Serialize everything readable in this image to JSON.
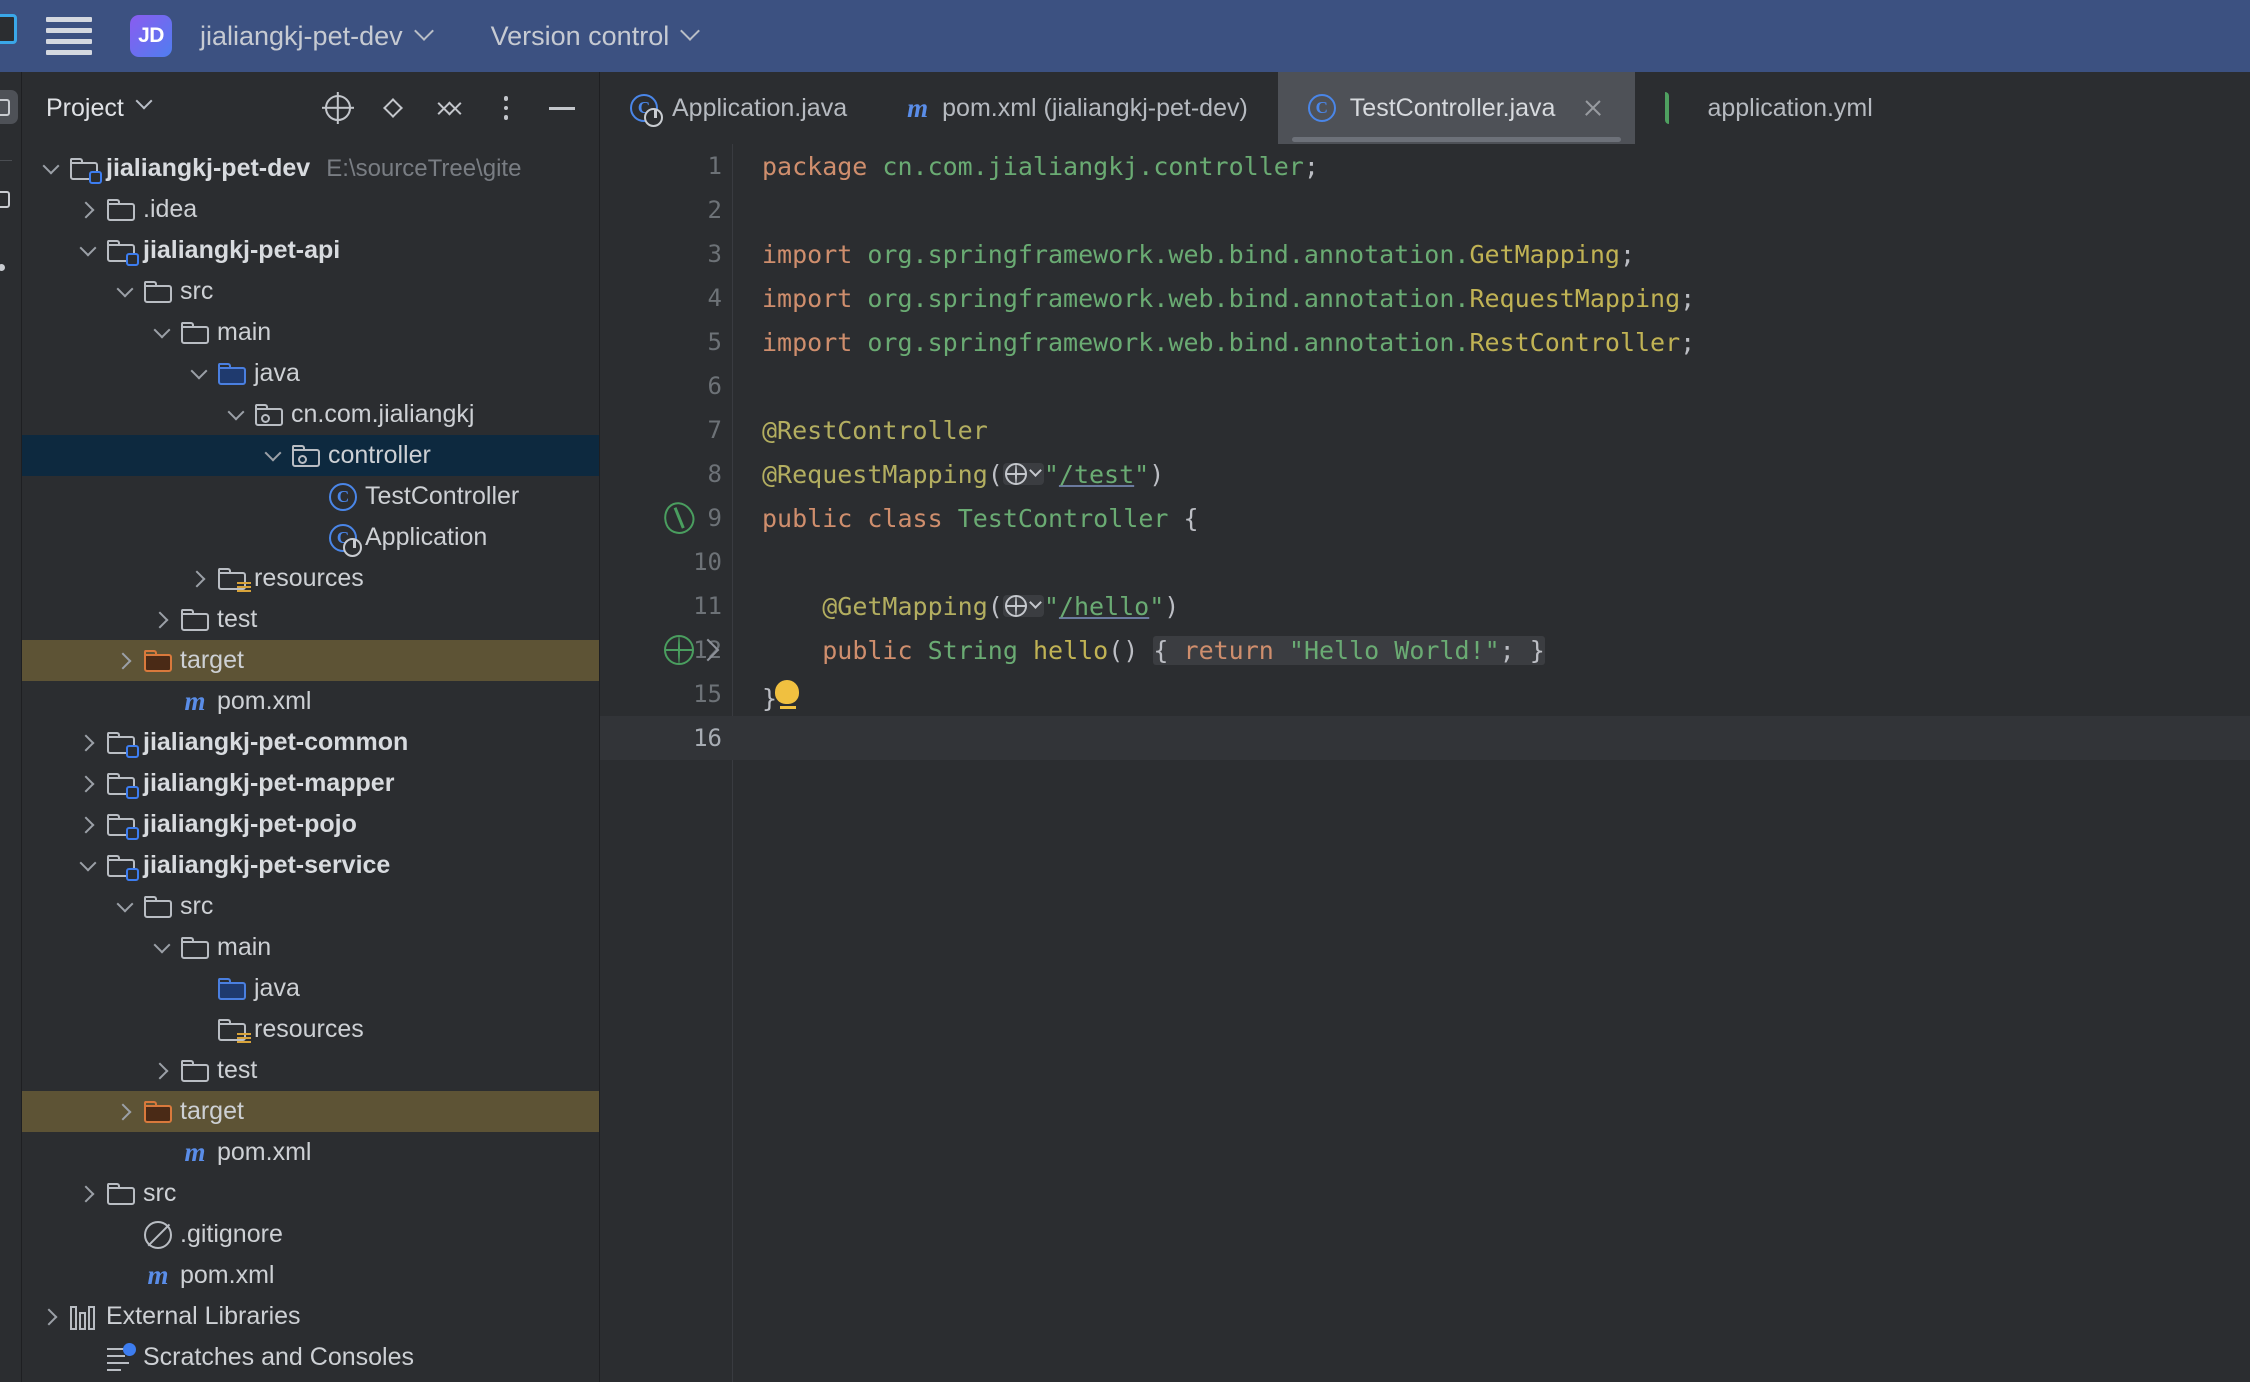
{
  "titlebar": {
    "project_badge": "JD",
    "project_name": "jialiangkj-pet-dev",
    "vcs_label": "Version control"
  },
  "project_panel": {
    "title": "Project",
    "actions": [
      {
        "name": "select-opened-file-icon",
        "label": "Select Opened File"
      },
      {
        "name": "expand-collapse-icon",
        "label": "Expand / Collapse"
      },
      {
        "name": "collapse-all-icon",
        "label": "Collapse All"
      },
      {
        "name": "options-icon",
        "label": "Options"
      },
      {
        "name": "hide-icon",
        "label": "Hide"
      }
    ],
    "tree": [
      {
        "label": "jialiangkj-pet-dev",
        "path": "E:\\sourceTree\\gite",
        "indent": 0,
        "arrow": "down",
        "icon": "module-folder",
        "bold": true,
        "state": "normal"
      },
      {
        "label": ".idea",
        "path": "",
        "indent": 1,
        "arrow": "right",
        "icon": "folder",
        "bold": false,
        "state": "normal"
      },
      {
        "label": "jialiangkj-pet-api",
        "path": "",
        "indent": 1,
        "arrow": "down",
        "icon": "module-folder",
        "bold": true,
        "state": "normal"
      },
      {
        "label": "src",
        "path": "",
        "indent": 2,
        "arrow": "down",
        "icon": "folder",
        "bold": false,
        "state": "normal"
      },
      {
        "label": "main",
        "path": "",
        "indent": 3,
        "arrow": "down",
        "icon": "folder",
        "bold": false,
        "state": "normal"
      },
      {
        "label": "java",
        "path": "",
        "indent": 4,
        "arrow": "down",
        "icon": "source-folder",
        "bold": false,
        "state": "normal"
      },
      {
        "label": "cn.com.jialiangkj",
        "path": "",
        "indent": 5,
        "arrow": "down",
        "icon": "package-folder",
        "bold": false,
        "state": "normal"
      },
      {
        "label": "controller",
        "path": "",
        "indent": 6,
        "arrow": "down",
        "icon": "package-folder",
        "bold": false,
        "state": "selected"
      },
      {
        "label": "TestController",
        "path": "",
        "indent": 7,
        "arrow": "none",
        "icon": "java-class",
        "bold": false,
        "state": "normal"
      },
      {
        "label": "Application",
        "path": "",
        "indent": 7,
        "arrow": "none",
        "icon": "java-class-runnable",
        "bold": false,
        "state": "normal"
      },
      {
        "label": "resources",
        "path": "",
        "indent": 4,
        "arrow": "right",
        "icon": "resources-folder",
        "bold": false,
        "state": "normal"
      },
      {
        "label": "test",
        "path": "",
        "indent": 3,
        "arrow": "right",
        "icon": "folder",
        "bold": false,
        "state": "normal"
      },
      {
        "label": "target",
        "path": "",
        "indent": 2,
        "arrow": "right",
        "icon": "excluded-folder",
        "bold": false,
        "state": "excluded"
      },
      {
        "label": "pom.xml",
        "path": "",
        "indent": 3,
        "arrow": "none",
        "icon": "maven-file",
        "bold": false,
        "state": "normal"
      },
      {
        "label": "jialiangkj-pet-common",
        "path": "",
        "indent": 1,
        "arrow": "right",
        "icon": "module-folder",
        "bold": true,
        "state": "normal"
      },
      {
        "label": "jialiangkj-pet-mapper",
        "path": "",
        "indent": 1,
        "arrow": "right",
        "icon": "module-folder",
        "bold": true,
        "state": "normal"
      },
      {
        "label": "jialiangkj-pet-pojo",
        "path": "",
        "indent": 1,
        "arrow": "right",
        "icon": "module-folder",
        "bold": true,
        "state": "normal"
      },
      {
        "label": "jialiangkj-pet-service",
        "path": "",
        "indent": 1,
        "arrow": "down",
        "icon": "module-folder",
        "bold": true,
        "state": "normal"
      },
      {
        "label": "src",
        "path": "",
        "indent": 2,
        "arrow": "down",
        "icon": "folder",
        "bold": false,
        "state": "normal"
      },
      {
        "label": "main",
        "path": "",
        "indent": 3,
        "arrow": "down",
        "icon": "folder",
        "bold": false,
        "state": "normal"
      },
      {
        "label": "java",
        "path": "",
        "indent": 4,
        "arrow": "none",
        "icon": "source-folder",
        "bold": false,
        "state": "normal"
      },
      {
        "label": "resources",
        "path": "",
        "indent": 4,
        "arrow": "none",
        "icon": "resources-folder",
        "bold": false,
        "state": "normal"
      },
      {
        "label": "test",
        "path": "",
        "indent": 3,
        "arrow": "right",
        "icon": "folder",
        "bold": false,
        "state": "normal"
      },
      {
        "label": "target",
        "path": "",
        "indent": 2,
        "arrow": "right",
        "icon": "excluded-folder",
        "bold": false,
        "state": "excluded"
      },
      {
        "label": "pom.xml",
        "path": "",
        "indent": 3,
        "arrow": "none",
        "icon": "maven-file",
        "bold": false,
        "state": "normal"
      },
      {
        "label": "src",
        "path": "",
        "indent": 1,
        "arrow": "right",
        "icon": "folder",
        "bold": false,
        "state": "normal"
      },
      {
        "label": ".gitignore",
        "path": "",
        "indent": 2,
        "arrow": "none",
        "icon": "gitignore-file",
        "bold": false,
        "state": "normal"
      },
      {
        "label": "pom.xml",
        "path": "",
        "indent": 2,
        "arrow": "none",
        "icon": "maven-file",
        "bold": false,
        "state": "normal"
      },
      {
        "label": "External Libraries",
        "path": "",
        "indent": 0,
        "arrow": "right",
        "icon": "library",
        "bold": false,
        "state": "normal"
      },
      {
        "label": "Scratches and Consoles",
        "path": "",
        "indent": 1,
        "arrow": "none",
        "icon": "scratches",
        "bold": false,
        "state": "normal"
      }
    ]
  },
  "tabs": [
    {
      "label": "Application.java",
      "icon": "java-class-runnable",
      "active": false,
      "closable": false
    },
    {
      "label": "pom.xml (jialiangkj-pet-dev)",
      "icon": "maven-file",
      "active": false,
      "closable": false
    },
    {
      "label": "TestController.java",
      "icon": "java-class",
      "active": true,
      "closable": true
    },
    {
      "label": "application.yml",
      "icon": "yaml-file",
      "active": false,
      "closable": false
    }
  ],
  "editor": {
    "file": "TestController.java",
    "lines": [
      {
        "num": "1",
        "gutter": "none",
        "current": false
      },
      {
        "num": "2",
        "gutter": "none",
        "current": false
      },
      {
        "num": "3",
        "gutter": "none",
        "current": false
      },
      {
        "num": "4",
        "gutter": "none",
        "current": false
      },
      {
        "num": "5",
        "gutter": "none",
        "current": false
      },
      {
        "num": "6",
        "gutter": "none",
        "current": false
      },
      {
        "num": "7",
        "gutter": "none",
        "current": false
      },
      {
        "num": "8",
        "gutter": "none",
        "current": false
      },
      {
        "num": "9",
        "gutter": "spring-bean",
        "current": false
      },
      {
        "num": "10",
        "gutter": "none",
        "current": false
      },
      {
        "num": "11",
        "gutter": "none",
        "current": false
      },
      {
        "num": "12",
        "gutter": "spring-endpoint",
        "current": false
      },
      {
        "num": "15",
        "gutter": "none",
        "current": false
      },
      {
        "num": "16",
        "gutter": "none",
        "current": true
      }
    ],
    "code_text": {
      "l1": "package cn.com.jialiangkj.controller;",
      "l3": "import org.springframework.web.bind.annotation.GetMapping;",
      "l4": "import org.springframework.web.bind.annotation.RequestMapping;",
      "l5": "import org.springframework.web.bind.annotation.RestController;",
      "l7": "@RestController",
      "l8": "@RequestMapping(\"/test\")",
      "l9": "public class TestController {",
      "l11": "@GetMapping(\"/hello\")",
      "l12": "public String hello() { return \"Hello World!\"; }",
      "l15": "}",
      "kw_package": "package",
      "pkg_name": "cn.com.jialiangkj.controller",
      "semicolon": ";",
      "kw_import": "import",
      "imp_pkg": "org.springframework.web.bind.annotation.",
      "imp_cls_get": "GetMapping",
      "imp_cls_req": "RequestMapping",
      "imp_cls_rest": "RestController",
      "ann_rest": "@RestController",
      "ann_reqmap": "@RequestMapping",
      "str_test": "\"/test\"",
      "str_test_inner": "/test",
      "kw_public": "public",
      "kw_class": "class",
      "cls_name": "TestController",
      "brace_open": "{",
      "ann_getmap": "@GetMapping",
      "str_hello": "/hello",
      "type_string": "String",
      "meth_hello": "hello",
      "parens": "()",
      "kw_return": "return",
      "str_hw": "\"Hello World!\"",
      "brace_close": "}",
      "paren_open": "(",
      "paren_close": ")",
      "quote": "\""
    }
  },
  "colors": {
    "titlebar_bg": "#3c5181",
    "panel_bg": "#2b2d30",
    "editor_bg": "#2b2d30",
    "selection_blue": "#0d293f",
    "excluded_olive": "#5d5335",
    "tab_active_bg": "#4e5157",
    "keyword_orange": "#cf8e6d",
    "string_green": "#6aab73",
    "annotation_yellow": "#b3ae60",
    "method_yellow": "#c1b354",
    "accent_blue": "#3d7df0",
    "spring_green": "#4a9e5f",
    "bulb_yellow": "#f0c040"
  }
}
